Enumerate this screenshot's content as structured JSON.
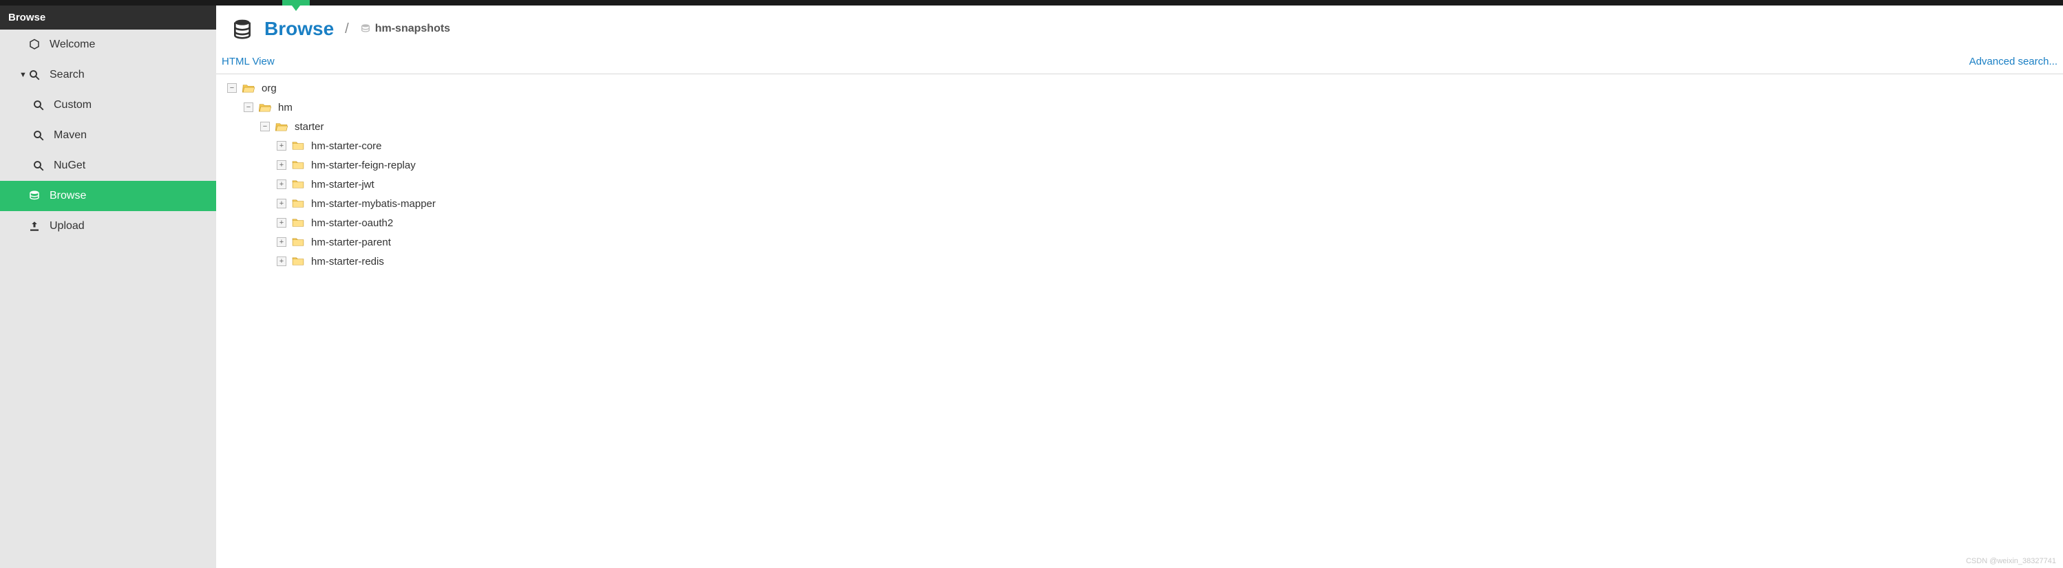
{
  "sidebar": {
    "header": "Browse",
    "items": [
      {
        "label": "Welcome",
        "icon": "hexagon-icon",
        "level": 1,
        "expandable": false,
        "active": false
      },
      {
        "label": "Search",
        "icon": "search-icon",
        "level": 1,
        "expandable": true,
        "expanded": true,
        "active": false
      },
      {
        "label": "Custom",
        "icon": "search-icon",
        "level": 2,
        "expandable": false,
        "active": false
      },
      {
        "label": "Maven",
        "icon": "search-icon",
        "level": 2,
        "expandable": false,
        "active": false
      },
      {
        "label": "NuGet",
        "icon": "search-icon",
        "level": 2,
        "expandable": false,
        "active": false
      },
      {
        "label": "Browse",
        "icon": "database-icon",
        "level": 1,
        "expandable": false,
        "active": true
      },
      {
        "label": "Upload",
        "icon": "upload-icon",
        "level": 1,
        "expandable": false,
        "active": false
      }
    ]
  },
  "header": {
    "title": "Browse",
    "crumb_repo": "hm-snapshots"
  },
  "toolbar": {
    "html_view": "HTML View",
    "advanced_search": "Advanced search..."
  },
  "tree": [
    {
      "depth": 0,
      "label": "org",
      "state": "open"
    },
    {
      "depth": 1,
      "label": "hm",
      "state": "open"
    },
    {
      "depth": 2,
      "label": "starter",
      "state": "open"
    },
    {
      "depth": 3,
      "label": "hm-starter-core",
      "state": "closed"
    },
    {
      "depth": 3,
      "label": "hm-starter-feign-replay",
      "state": "closed"
    },
    {
      "depth": 3,
      "label": "hm-starter-jwt",
      "state": "closed"
    },
    {
      "depth": 3,
      "label": "hm-starter-mybatis-mapper",
      "state": "closed"
    },
    {
      "depth": 3,
      "label": "hm-starter-oauth2",
      "state": "closed"
    },
    {
      "depth": 3,
      "label": "hm-starter-parent",
      "state": "closed"
    },
    {
      "depth": 3,
      "label": "hm-starter-redis",
      "state": "closed"
    }
  ],
  "watermark": "CSDN @weixin_38327741"
}
